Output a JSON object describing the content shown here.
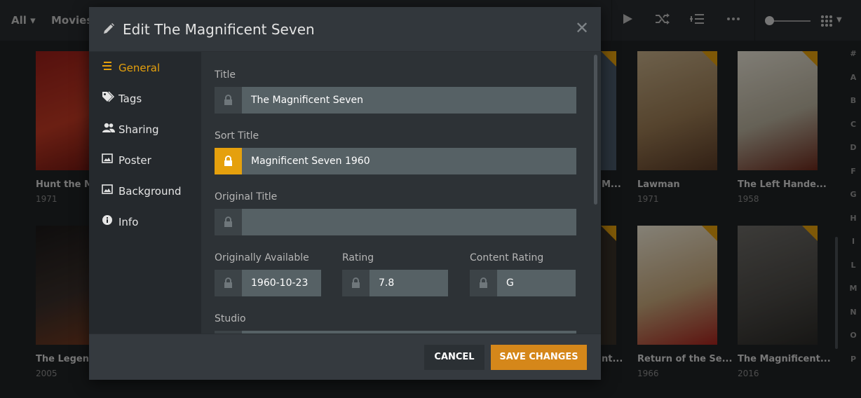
{
  "topbar": {
    "library_all": "All ▾",
    "library_movies": "Movies",
    "play_icon": "play-icon",
    "shuffle_icon": "shuffle-icon",
    "queue_icon": "add-to-queue-icon",
    "more_icon": "more-icon"
  },
  "posters": [
    {
      "title": "Hunt the Ma",
      "year": "1971",
      "colors": [
        "#9b1f1a",
        "#c33a24",
        "#6b1410"
      ]
    },
    {
      "title": "Lawman",
      "year": "1971",
      "colors": [
        "#c7b08a",
        "#9c7c54",
        "#5b3b26"
      ]
    },
    {
      "title": "The Left Hande...",
      "year": "1958",
      "colors": [
        "#e9e4d6",
        "#b9b19d",
        "#6e2a1c"
      ]
    },
    {
      "title": "The Legend",
      "year": "2005",
      "colors": [
        "#1c1a1a",
        "#3a2f2a",
        "#7b3a1e"
      ]
    },
    {
      "title": "Return of the Se...",
      "year": "1966",
      "colors": [
        "#f1ead7",
        "#c8a97c",
        "#a9241e"
      ]
    },
    {
      "title": "The Magnificent...",
      "year": "2016",
      "colors": [
        "#6d6b67",
        "#4d4b47",
        "#2b2a27"
      ]
    }
  ],
  "partial_titles": [
    "M...",
    "nt..."
  ],
  "alphabet": [
    "#",
    "A",
    "B",
    "C",
    "D",
    "F",
    "G",
    "H",
    "I",
    "L",
    "M",
    "N",
    "O",
    "P"
  ],
  "modal": {
    "title": "Edit The Magnificent Seven",
    "sidebar": [
      {
        "label": "General",
        "icon": "list-icon",
        "active": true
      },
      {
        "label": "Tags",
        "icon": "tag-icon",
        "active": false
      },
      {
        "label": "Sharing",
        "icon": "users-icon",
        "active": false
      },
      {
        "label": "Poster",
        "icon": "image-icon",
        "active": false
      },
      {
        "label": "Background",
        "icon": "image-icon",
        "active": false
      },
      {
        "label": "Info",
        "icon": "info-icon",
        "active": false
      }
    ],
    "fields": {
      "title": {
        "label": "Title",
        "value": "The Magnificent Seven",
        "locked": false
      },
      "sort_title": {
        "label": "Sort Title",
        "value": "Magnificent Seven 1960",
        "locked": true
      },
      "original_title": {
        "label": "Original Title",
        "value": "",
        "locked": false
      },
      "originally_available": {
        "label": "Originally Available",
        "value": "1960-10-23",
        "locked": false
      },
      "rating": {
        "label": "Rating",
        "value": "7.8",
        "locked": false
      },
      "content_rating": {
        "label": "Content Rating",
        "value": "G",
        "locked": false
      },
      "studio": {
        "label": "Studio",
        "value": "",
        "locked": false
      }
    },
    "buttons": {
      "cancel": "CANCEL",
      "save": "SAVE CHANGES"
    }
  },
  "colors": {
    "accent": "#e5a00d",
    "save_button": "#d5871a"
  }
}
